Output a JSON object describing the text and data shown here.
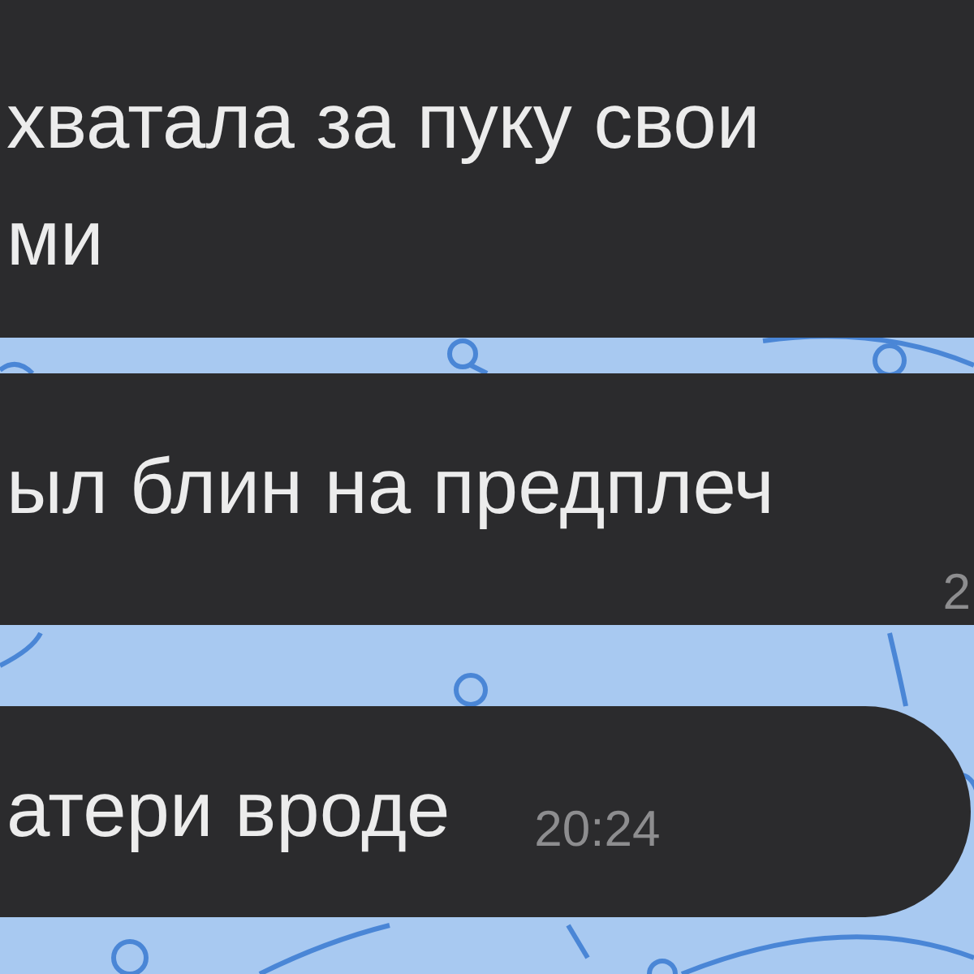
{
  "messages": [
    {
      "lines": [
        "хватала за пуку свои",
        "ми"
      ]
    },
    {
      "lines": [
        "ыл блин на предплеч"
      ],
      "time": "2"
    },
    {
      "lines": [
        "атери вроде"
      ],
      "time": "20:24"
    }
  ]
}
